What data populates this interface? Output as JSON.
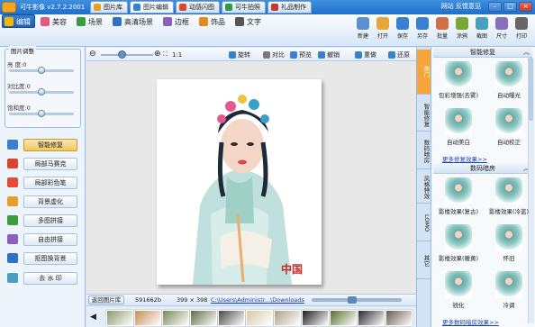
{
  "app": {
    "title": "可牛影像 v2.7.2.2001"
  },
  "top_tabs": [
    {
      "label": "图片库",
      "color": "#e2a12a"
    },
    {
      "label": "图片编辑",
      "color": "#3a7fd0"
    },
    {
      "label": "动感闪图",
      "color": "#d9452f"
    },
    {
      "label": "可牛拍照",
      "color": "#2f9a45"
    },
    {
      "label": "礼品制作",
      "color": "#c6392e"
    }
  ],
  "window": {
    "links": "网站  反馈意见"
  },
  "tools": [
    {
      "label": "编辑",
      "color": "#f5b700"
    },
    {
      "label": "美容",
      "color": "#e45a7c"
    },
    {
      "label": "场景",
      "color": "#3a9d3a"
    },
    {
      "label": "高清场景",
      "color": "#2d72c7"
    },
    {
      "label": "边框",
      "color": "#8b5fbf"
    },
    {
      "label": "饰品",
      "color": "#e38a21"
    },
    {
      "label": "文字",
      "color": "#555555"
    }
  ],
  "right_buttons": [
    {
      "label": "新建",
      "color": "#5b8fd0"
    },
    {
      "label": "打开",
      "color": "#e5a63a"
    },
    {
      "label": "保存",
      "color": "#3a7fd0"
    },
    {
      "label": "另存",
      "color": "#3a7fd0"
    },
    {
      "label": "批量",
      "color": "#d0704a"
    },
    {
      "label": "涂鸦",
      "color": "#7aa63a"
    },
    {
      "label": "截图",
      "color": "#4a9fc0"
    },
    {
      "label": "尺寸",
      "color": "#8b6fbf"
    },
    {
      "label": "打印",
      "color": "#666666"
    }
  ],
  "adjust": {
    "title": "图片调整",
    "sliders": [
      {
        "label": "亮 度:0",
        "value": 0
      },
      {
        "label": "对比度:0",
        "value": 0
      },
      {
        "label": "饱和度:0",
        "value": 0
      }
    ]
  },
  "side_buttons": [
    {
      "label": "智能修复",
      "color": "#3a7fd0",
      "active": true
    },
    {
      "label": "局部马赛克",
      "color": "#d9452f",
      "active": false
    },
    {
      "label": "局部彩色笔",
      "color": "#e84a3a",
      "active": false
    },
    {
      "label": "背景虚化",
      "color": "#e3a12a",
      "active": false
    },
    {
      "label": "多图拼接",
      "color": "#3a9d3a",
      "active": false
    },
    {
      "label": "自由拼接",
      "color": "#8b5fbf",
      "active": false
    },
    {
      "label": "抠图换背景",
      "color": "#2d72c7",
      "active": false
    },
    {
      "label": "去 水 印",
      "color": "#4a9fc0",
      "active": false
    }
  ],
  "edit_toolbar": {
    "zoom_label": "1:1",
    "zoom_level": 0.4,
    "buttons": [
      {
        "label": "旋转",
        "color": "#3a7fd0"
      },
      {
        "label": "对比",
        "color": "#7a7a7a"
      },
      {
        "label": "预览",
        "color": "#3a7fd0"
      },
      {
        "label": "撤销",
        "color": "#3a7fd0"
      },
      {
        "label": "重做",
        "color": "#3a7fd0"
      },
      {
        "label": "还原",
        "color": "#3a7fd0"
      }
    ]
  },
  "canvas": {
    "watermark": "中国"
  },
  "status": {
    "return_label": "返回图片库",
    "file_size": "591662b",
    "dims": "399 × 398",
    "path": "C:\\Users\\Administr...\\Downloads"
  },
  "right_tabs": [
    "热门",
    "智能修复",
    "数码暗房",
    "风格特效",
    "LOMO",
    "其它"
  ],
  "effects": {
    "group1_title": "智能修复",
    "group1": [
      "包彩增强(去雾)",
      "自动曝光",
      "自动美白",
      "自动校正"
    ],
    "more1": "更多修复效果>>",
    "group2_title": "数码暗房",
    "group2": [
      "影楼效果(复古)",
      "影楼效果(冷蓝)",
      "影楼效果(暖黄)",
      "怀旧",
      "锐化",
      "冷调"
    ],
    "more2": "更多数码暗房效果>>"
  },
  "thumbnails": [
    "#8a9a6a",
    "#c58f55",
    "#7a8a5a",
    "#5e6f46",
    "#4a4a4a",
    "#d6c9a8",
    "#b0a08a",
    "#1d1d1d",
    "#5a7030",
    "#2a2a30",
    "#6a5a50"
  ]
}
